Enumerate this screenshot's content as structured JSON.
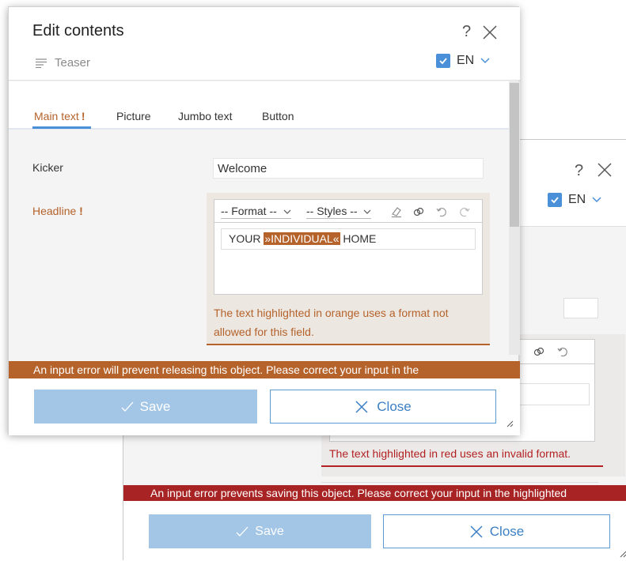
{
  "back_dialog": {
    "help_label": "?",
    "lang": "EN",
    "error_text": "The text highlighted in red uses an invalid format.",
    "banner": "An input error prevents saving this object. Please correct your input in the highlighted",
    "save_label": "Save",
    "close_label": "Close"
  },
  "front_dialog": {
    "title": "Edit contents",
    "help_label": "?",
    "subtitle": "Teaser",
    "lang": "EN",
    "tabs": [
      {
        "label": "Main text",
        "error_mark": "!"
      },
      {
        "label": "Picture"
      },
      {
        "label": "Jumbo text"
      },
      {
        "label": "Button"
      }
    ],
    "fields": {
      "kicker_label": "Kicker",
      "kicker_value": "Welcome",
      "headline_label": "Headline",
      "headline_error_mark": "!"
    },
    "editor": {
      "format_select": "-- Format --",
      "styles_select": "-- Styles --",
      "text_before": "YOUR ",
      "text_highlighted": "»INDIVIDUAL«",
      "text_after": " HOME",
      "error_text": "The text highlighted in orange uses a format not allowed for this field."
    },
    "banner": "An input error will prevent releasing this object. Please correct your input in the",
    "save_label": "Save",
    "close_label": "Close"
  },
  "colors": {
    "accent": "#4a90d9",
    "warning": "#b5622b",
    "error": "#a82424",
    "save_button": "#a3c6e6"
  }
}
